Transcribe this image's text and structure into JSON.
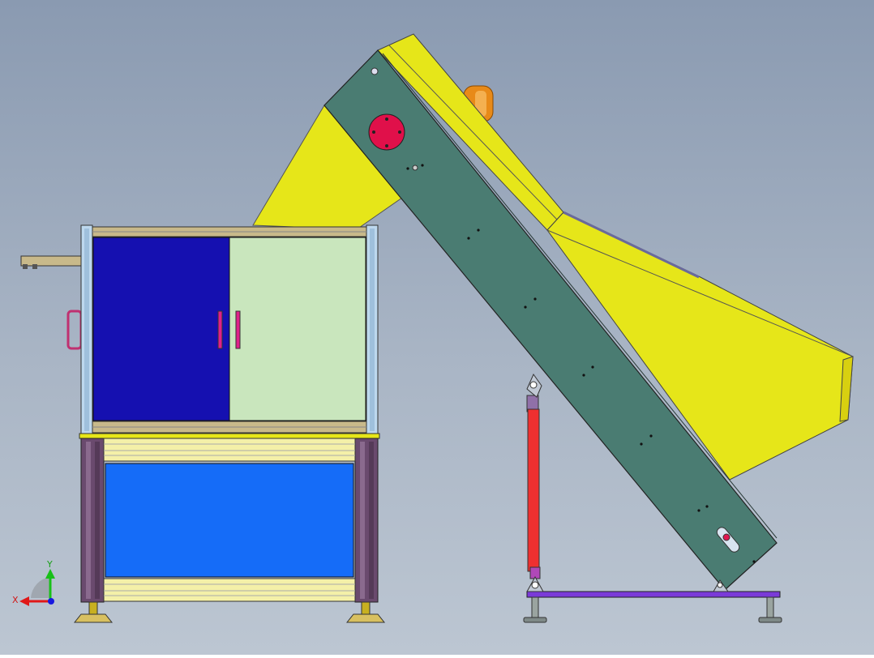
{
  "colors": {
    "background_top": "#8a9ab1",
    "background_bottom": "#bcc6d2",
    "conveyor_frame": "#4a7c72",
    "hopper_yellow": "#e6e619",
    "red_disc": "#e0104a",
    "left_door": "#1510b0",
    "right_door": "#c9e6bd",
    "lower_panel": "#156cf8",
    "frame_post_light": "#bdd8ee",
    "frame_post_dark": "#6a4a6e",
    "crossbar_tan": "#c8b98a",
    "support_strut": "#ee3030",
    "base_plate": "#7a3ad8",
    "door_handle": "#e0208a",
    "feet_gold": "#c8b020",
    "motor_orange": "#e88a18"
  },
  "axis_triad": {
    "x_label": "X",
    "y_label": "Y",
    "x_color": "#e01818",
    "y_color": "#18c018",
    "z_color": "#1818e0"
  },
  "icons": [
    "coordinate-triad-icon"
  ]
}
